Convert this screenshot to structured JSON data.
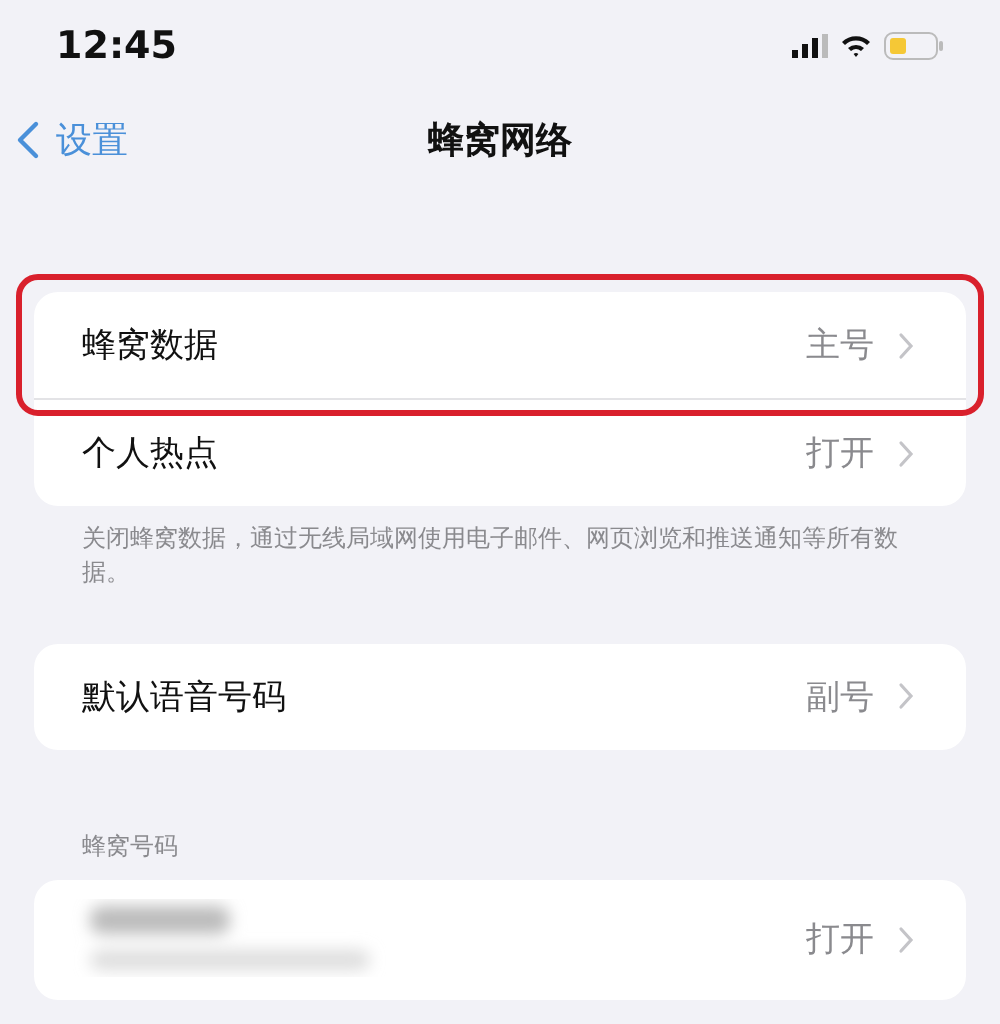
{
  "status_bar": {
    "time": "12:45"
  },
  "nav": {
    "back": "设置",
    "title": "蜂窝网络"
  },
  "groups": [
    {
      "rows": [
        {
          "kind": "link",
          "label": "蜂窝数据",
          "value": "主号",
          "highlighted": true
        },
        {
          "kind": "link",
          "label": "个人热点",
          "value": "打开",
          "highlighted": false
        }
      ],
      "footer": "关闭蜂窝数据，通过无线局域网使用电子邮件、网页浏览和推送通知等所有数据。"
    },
    {
      "rows": [
        {
          "kind": "link",
          "label": "默认语音号码",
          "value": "副号"
        }
      ]
    },
    {
      "header": "蜂窝号码",
      "rows": [
        {
          "kind": "blurred",
          "value": "打开"
        }
      ]
    }
  ]
}
